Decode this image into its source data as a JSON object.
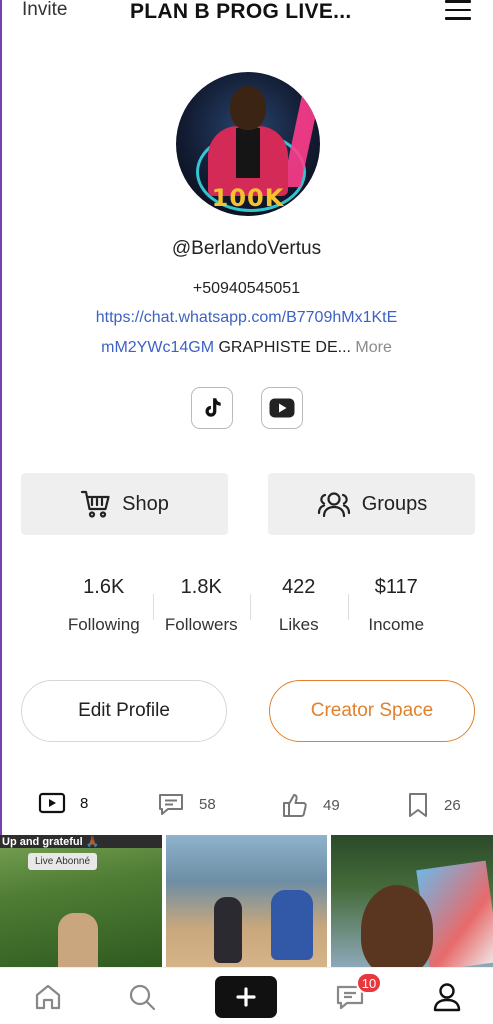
{
  "header": {
    "invite": "Invite",
    "title": "PLAN B PROG  LIVE...",
    "menu_icon": "hamburger-menu-icon"
  },
  "profile": {
    "avatar_badge": "100K",
    "username": "@BerlandoVertus",
    "phone": "+50940545051",
    "link_line1": "https://chat.whatsapp.com/B7709hMx1KtE",
    "link_line2": "mM2YWc14GM",
    "bio": "GRAPHISTE DE...",
    "more": "More"
  },
  "socials": [
    {
      "icon": "tiktok-icon"
    },
    {
      "icon": "youtube-icon"
    }
  ],
  "actions": {
    "shop": "Shop",
    "groups": "Groups"
  },
  "stats": [
    {
      "value": "1.6K",
      "label": "Following"
    },
    {
      "value": "1.8K",
      "label": "Followers"
    },
    {
      "value": "422",
      "label": "Likes"
    },
    {
      "value": "$117",
      "label": "Income"
    }
  ],
  "buttons": {
    "edit_profile": "Edit Profile",
    "creator_space": "Creator Space"
  },
  "tabs": [
    {
      "icon": "video-icon",
      "count": "8"
    },
    {
      "icon": "comment-icon",
      "count": "58"
    },
    {
      "icon": "thumbs-up-icon",
      "count": "49"
    },
    {
      "icon": "bookmark-icon",
      "count": "26"
    }
  ],
  "grid": {
    "thumb1_banner": "Up and grateful 🙏🏾",
    "thumb1_tag": "Live Abonné"
  },
  "bottom_nav": {
    "messages_badge": "10"
  },
  "colors": {
    "accent_orange": "#e0822c",
    "link_blue": "#3d62c4",
    "badge_red": "#e8383d"
  }
}
